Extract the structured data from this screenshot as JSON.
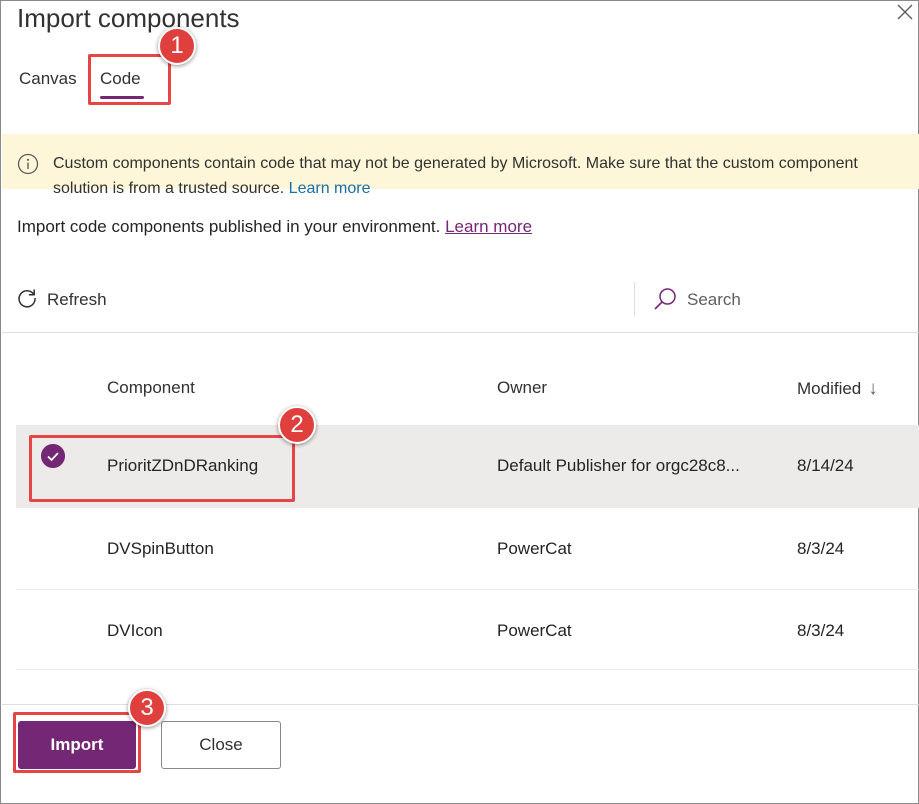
{
  "dialog": {
    "title": "Import components"
  },
  "tabs": [
    {
      "label": "Canvas",
      "selected": false
    },
    {
      "label": "Code",
      "selected": true
    }
  ],
  "banner": {
    "text": "Custom components contain code that may not be generated by Microsoft. Make sure that the custom component solution is from a trusted source.",
    "link": "Learn more",
    "icon": "info-icon",
    "background": "#fdf6d8"
  },
  "subtitle": {
    "text": "Import code components published in your environment.",
    "link": "Learn more"
  },
  "toolbar": {
    "refresh_label": "Refresh",
    "search_placeholder": "Search"
  },
  "table": {
    "columns": [
      "Component",
      "Owner",
      "Modified"
    ],
    "sort_indicator": "↓",
    "rows": [
      {
        "name": "PrioritZDnDRanking",
        "owner": "Default Publisher for orgc28c8...",
        "modified": "8/14/24",
        "selected": true
      },
      {
        "name": "DVSpinButton",
        "owner": "PowerCat",
        "modified": "8/3/24",
        "selected": false
      },
      {
        "name": "DVIcon",
        "owner": "PowerCat",
        "modified": "8/3/24",
        "selected": false
      }
    ]
  },
  "footer": {
    "import_label": "Import",
    "close_label": "Close"
  },
  "callouts": [
    "1",
    "2",
    "3"
  ],
  "colors": {
    "accent": "#742774",
    "callout": "#e0403d",
    "selected_row": "#edebe9"
  }
}
